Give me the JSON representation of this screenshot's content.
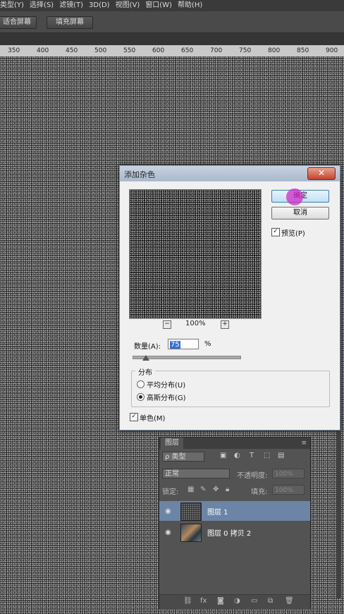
{
  "menu": [
    "类型(Y)",
    "选择(S)",
    "滤镜(T)",
    "3D(D)",
    "视图(V)",
    "窗口(W)",
    "帮助(H)"
  ],
  "options": {
    "fit_screen": "适合屏幕",
    "fill_screen": "填充屏幕"
  },
  "ruler": [
    "350",
    "400",
    "450",
    "500",
    "550",
    "600",
    "650",
    "700",
    "750",
    "800",
    "850",
    "900"
  ],
  "dialog": {
    "title": "添加杂色",
    "close": "✕",
    "ok": "确定",
    "cancel": "取消",
    "preview_label": "预览(P)",
    "zoom_out": "−",
    "zoom": "100%",
    "zoom_in": "+",
    "amount_label": "数量(A):",
    "amount_value": "75",
    "amount_unit": "%",
    "amount_level_percent": 12.5,
    "distribution_title": "分布",
    "uniform_label": "平均分布(U)",
    "gaussian_label": "高斯分布(G)",
    "mono_label": "单色(M)"
  },
  "layers": {
    "tab": "图层",
    "filter_kind": "ρ 类型",
    "blend_mode": "正常",
    "opacity_label": "不透明度:",
    "opacity_value": "100%",
    "lock_label": "锁定:",
    "fill_label": "填充:",
    "fill_value": "100%",
    "items": [
      {
        "name": "图层 1",
        "selected": true
      },
      {
        "name": "图层 0 拷贝 2",
        "selected": false
      }
    ]
  }
}
